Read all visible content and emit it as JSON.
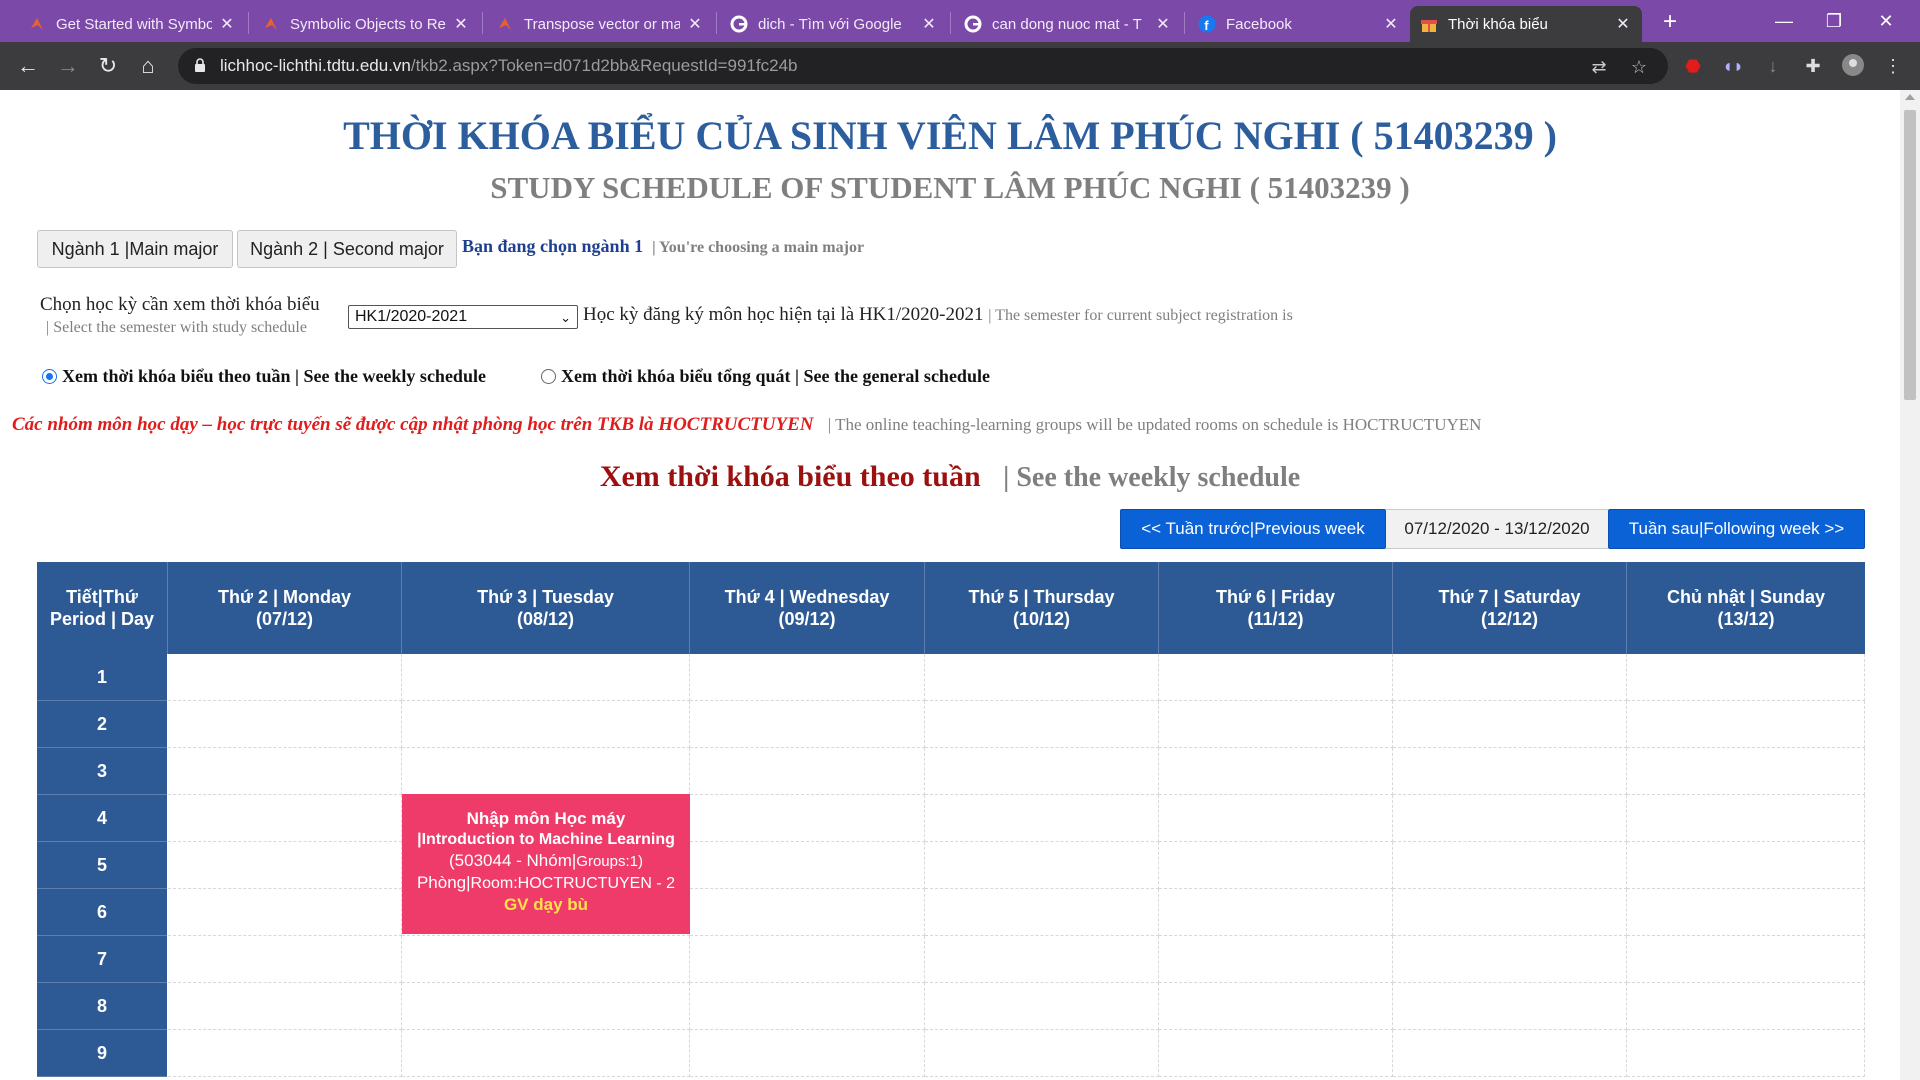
{
  "browser": {
    "tabs": [
      {
        "title": "Get Started with Symbo",
        "icon": "matlab-icon"
      },
      {
        "title": "Symbolic Objects to Re",
        "icon": "matlab-icon"
      },
      {
        "title": "Transpose vector or ma",
        "icon": "matlab-icon"
      },
      {
        "title": "dich - Tìm với Google",
        "icon": "google-icon"
      },
      {
        "title": "can dong nuoc mat - T",
        "icon": "google-icon"
      },
      {
        "title": "Facebook",
        "icon": "facebook-icon"
      },
      {
        "title": "Thời khóa biểu",
        "icon": "gift-icon"
      }
    ],
    "url_host": "lichhoc-lichthi.tdtu.edu.vn",
    "url_path": "/tkb2.aspx?Token=d071d2bb&RequestId=991fc24b"
  },
  "page": {
    "title_vn": "THỜI KHÓA BIỂU CỦA SINH VIÊN LÂM PHÚC NGHI ( 51403239 )",
    "title_en": "STUDY SCHEDULE OF STUDENT LÂM PHÚC NGHI ( 51403239 )",
    "major1_label": "Ngành 1 |Main major",
    "major2_label": "Ngành 2 | Second major",
    "major_note_vn": "Bạn đang chọn ngành 1",
    "major_note_en": "| You're choosing a main major",
    "semester_label_vn": "Chọn học kỳ cần xem thời khóa biểu",
    "semester_label_en": "| Select the semester with study schedule",
    "semester_selected": "HK1/2020-2021",
    "semester_current_vn": "Học kỳ đăng ký môn học hiện tại là HK1/2020-2021",
    "semester_current_en": "| The semester for current subject registration is",
    "radio_weekly": "Xem thời khóa biểu theo tuần | See the weekly schedule",
    "radio_general": "Xem thời khóa biểu tổng quát | See the general schedule",
    "notice_vn": "Các nhóm môn học dạy – học trực tuyến sẽ được cập nhật phòng học trên TKB là HOCTRUCTUYEN",
    "notice_en": "| The online teaching-learning groups will be updated rooms on schedule is HOCTRUCTUYEN",
    "weekly_title_vn": "Xem thời khóa biểu theo tuần",
    "weekly_title_en": "| See the weekly schedule",
    "prev_week": "<< Tuần trước|Previous week",
    "week_range": "07/12/2020 - 13/12/2020",
    "next_week": "Tuần sau|Following week >>"
  },
  "schedule": {
    "corner_header": "Tiết|Thứ Period | Day",
    "days": [
      {
        "name": "Thứ 2 | Monday",
        "date": "(07/12)"
      },
      {
        "name": "Thứ 3 | Tuesday",
        "date": "(08/12)"
      },
      {
        "name": "Thứ 4 | Wednesday",
        "date": "(09/12)"
      },
      {
        "name": "Thứ 5 | Thursday",
        "date": "(10/12)"
      },
      {
        "name": "Thứ 6 | Friday",
        "date": "(11/12)"
      },
      {
        "name": "Thứ 7 | Saturday",
        "date": "(12/12)"
      },
      {
        "name": "Chủ nhật | Sunday",
        "date": "(13/12)"
      }
    ],
    "periods": [
      "1",
      "2",
      "3",
      "4",
      "5",
      "6",
      "7",
      "8",
      "9"
    ],
    "course": {
      "name_vn": "Nhập môn Học máy",
      "name_en": "|Introduction to Machine Learning",
      "code_group": "(503044 - Nhóm|",
      "groups_label": "Groups:1)",
      "room_prefix": "Phòng|",
      "room": "Room:HOCTRUCTUYEN - 2",
      "note": "GV dạy bù"
    }
  },
  "colors": {
    "header_blue": "#2d5a94",
    "title_blue": "#2c5e9e",
    "course_pink": "#ef3b6a",
    "notice_red": "#e01c1c",
    "tab_purple": "#7b4aa8"
  }
}
